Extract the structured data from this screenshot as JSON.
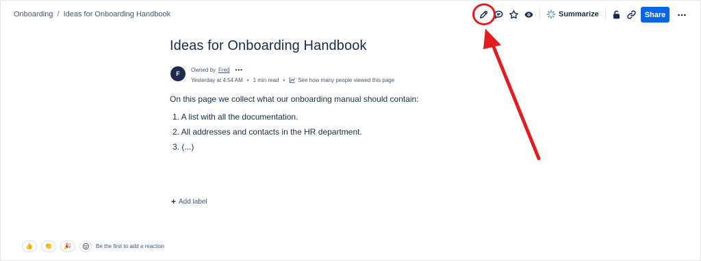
{
  "breadcrumb": {
    "space": "Onboarding",
    "separator": "/",
    "page": "Ideas for Onboarding Handbook"
  },
  "toolbar": {
    "icons": [
      "edit-icon",
      "comment-icon",
      "star-icon",
      "watch-icon",
      "summarize-icon",
      "restrictions-icon",
      "link-icon",
      "more-icon"
    ],
    "summarize_label": "Summarize",
    "share_label": "Share",
    "more_label": "•••"
  },
  "page": {
    "title": "Ideas for Onboarding Handbook",
    "avatar_initial": "F",
    "owned_by_label": "Owned by",
    "owner_name": "Fred",
    "owner_more": "•••",
    "updated": "Yesterday at 4:54 AM",
    "bullet": "•",
    "read_time": "1 min read",
    "views_label": "See how many people viewed this page",
    "intro": "On this page we collect what our onboarding manual should contain:",
    "list_items": [
      "1. A list with all the documentation.",
      "2. All addresses and contacts in the HR department.",
      "3. (...)"
    ],
    "add_label": "Add label",
    "add_label_icon": "+"
  },
  "reactions": {
    "items": [
      {
        "name": "thumbs-up",
        "glyph": "👍"
      },
      {
        "name": "clapping",
        "glyph": "👏"
      },
      {
        "name": "party",
        "glyph": "🎉"
      }
    ],
    "prompt": "Be the first to add a reaction"
  },
  "colors": {
    "accent": "#0c66e4",
    "annotation": "#e11d21",
    "text": "#172b4d",
    "subtle_text": "#44546f"
  }
}
